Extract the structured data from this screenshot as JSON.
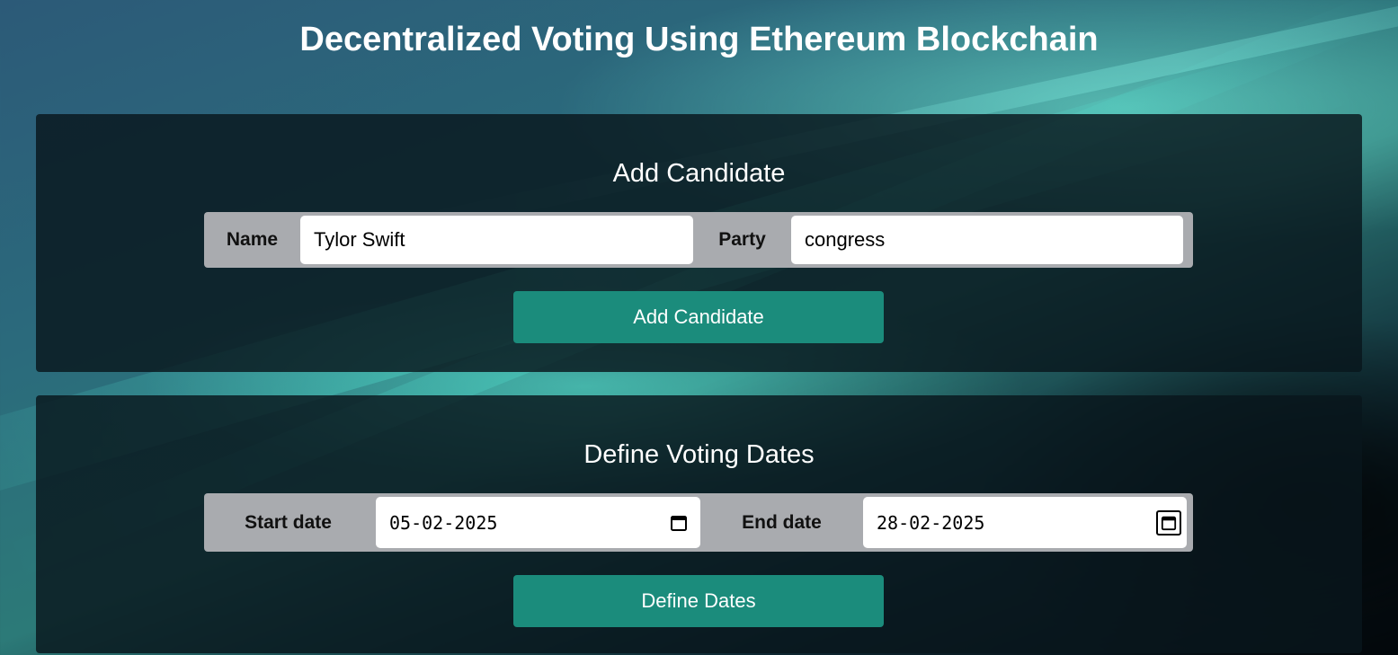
{
  "header": {
    "title": "Decentralized Voting Using Ethereum Blockchain"
  },
  "add_candidate": {
    "title": "Add Candidate",
    "name_label": "Name",
    "name_value": "Tylor Swift",
    "party_label": "Party",
    "party_value": "congress",
    "button_label": "Add Candidate"
  },
  "voting_dates": {
    "title": "Define Voting Dates",
    "start_label": "Start date",
    "start_value": "05-02-2025",
    "end_label": "End date",
    "end_value": "28-02-2025",
    "button_label": "Define Dates"
  },
  "icons": {
    "start_date_picker": "calendar-icon",
    "end_date_picker": "calendar-icon"
  },
  "colors": {
    "button": "#1b8c7c",
    "card": "#08161c",
    "row": "#a9abaf"
  }
}
